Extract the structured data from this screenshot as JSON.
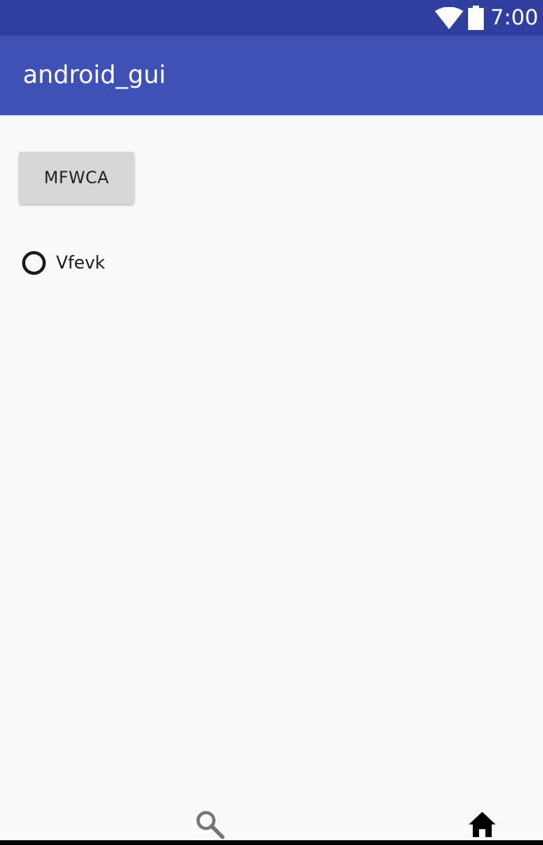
{
  "status_bar": {
    "time": "7:00",
    "icons": [
      "wifi-icon",
      "battery-icon"
    ]
  },
  "app_bar": {
    "title": "android_gui"
  },
  "content": {
    "button_label": "MFWCA",
    "radio": {
      "label": "Vfevk",
      "checked": false
    }
  },
  "bottom_nav": {
    "icons": [
      "search-icon",
      "home-icon"
    ]
  },
  "colors": {
    "status_bar": "#303f9f",
    "app_bar": "#3f51b5",
    "background": "#fafafa",
    "button": "#d6d7d7"
  }
}
